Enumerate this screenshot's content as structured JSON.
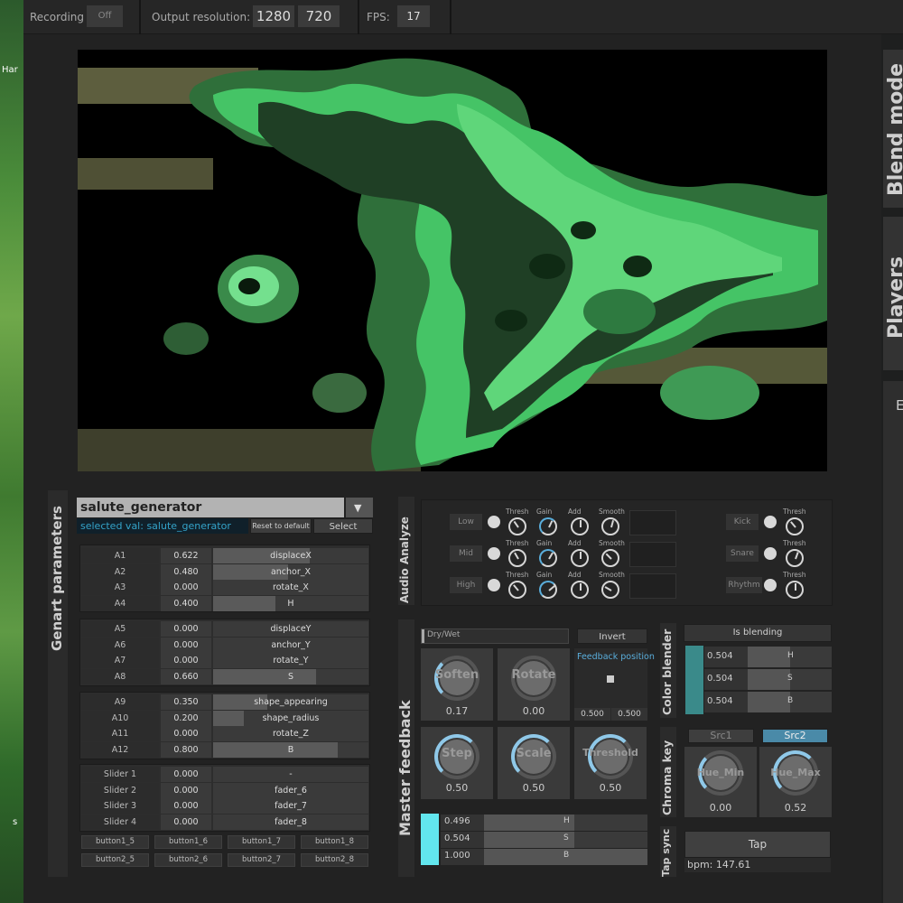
{
  "desktop": {
    "icon_label": "Har",
    "bottom_label": "s"
  },
  "topbar": {
    "recording_label": "Recording",
    "recording_value": "Off",
    "resolution_label": "Output resolution:",
    "res_w": "1280",
    "res_h": "720",
    "fps_label": "FPS:",
    "fps_value": "17"
  },
  "side_tabs": {
    "blend": "Blend mode",
    "players": "Players",
    "third": "E"
  },
  "genart": {
    "section_title": "Genart parameters",
    "selected_generator": "salute_generator",
    "selected_val_text": "selected val: salute_generator",
    "reset_label": "Reset to default",
    "select_label": "Select",
    "groups": [
      [
        {
          "name": "A1",
          "value": "0.622",
          "target": "displaceX",
          "level": 0.622
        },
        {
          "name": "A2",
          "value": "0.480",
          "target": "anchor_X",
          "level": 0.48
        },
        {
          "name": "A3",
          "value": "0.000",
          "target": "rotate_X",
          "level": 0
        },
        {
          "name": "A4",
          "value": "0.400",
          "target": "H",
          "level": 0.4
        }
      ],
      [
        {
          "name": "A5",
          "value": "0.000",
          "target": "displaceY",
          "level": 0
        },
        {
          "name": "A6",
          "value": "0.000",
          "target": "anchor_Y",
          "level": 0
        },
        {
          "name": "A7",
          "value": "0.000",
          "target": "rotate_Y",
          "level": 0
        },
        {
          "name": "A8",
          "value": "0.660",
          "target": "S",
          "level": 0.66
        }
      ],
      [
        {
          "name": "A9",
          "value": "0.350",
          "target": "shape_appearing",
          "level": 0.35
        },
        {
          "name": "A10",
          "value": "0.200",
          "target": "shape_radius",
          "level": 0.2
        },
        {
          "name": "A11",
          "value": "0.000",
          "target": "rotate_Z",
          "level": 0
        },
        {
          "name": "A12",
          "value": "0.800",
          "target": "B",
          "level": 0.8
        }
      ],
      [
        {
          "name": "Slider 1",
          "value": "0.000",
          "target": "-",
          "level": 0
        },
        {
          "name": "Slider 2",
          "value": "0.000",
          "target": "fader_6",
          "level": 0
        },
        {
          "name": "Slider 3",
          "value": "0.000",
          "target": "fader_7",
          "level": 0
        },
        {
          "name": "Slider 4",
          "value": "0.000",
          "target": "fader_8",
          "level": 0
        }
      ]
    ],
    "buttons_row1": [
      "button1_5",
      "button1_6",
      "button1_7",
      "button1_8"
    ],
    "buttons_row2": [
      "button2_5",
      "button2_6",
      "button2_7",
      "button2_8"
    ]
  },
  "audio": {
    "section_title": "Audio Analyze",
    "bands": [
      "Low",
      "Mid",
      "High"
    ],
    "knob_labels": [
      "Thresh",
      "Gain",
      "Add",
      "Smooth"
    ],
    "beats": [
      "Kick",
      "Snare",
      "Rhythm"
    ],
    "beat_knob_label": "Thresh"
  },
  "feedback": {
    "section_title": "Master feedback",
    "drywet_label": "Dry/Wet",
    "invert_label": "Invert",
    "position_label": "Feedback position",
    "pos_x": "0.500",
    "pos_y": "0.500",
    "knobs": [
      {
        "label": "Soften",
        "value": "0.17"
      },
      {
        "label": "Rotate",
        "value": "0.00"
      },
      {
        "label": "Step",
        "value": "0.50"
      },
      {
        "label": "Scale",
        "value": "0.50"
      },
      {
        "label": "Threshold",
        "value": "0.50"
      }
    ],
    "rgb_rows": [
      {
        "value": "0.496",
        "channel": "H",
        "level": 0.55
      },
      {
        "value": "0.504",
        "channel": "S",
        "level": 0.55
      },
      {
        "value": "1.000",
        "channel": "B",
        "level": 1.0
      }
    ]
  },
  "color_blender": {
    "section_title": "Color blender",
    "is_blending_label": "Is blending",
    "rows": [
      {
        "value": "0.504",
        "channel": "H"
      },
      {
        "value": "0.504",
        "channel": "S"
      },
      {
        "value": "0.504",
        "channel": "B"
      }
    ]
  },
  "chroma": {
    "section_title": "Chroma key",
    "src1": "Src1",
    "src2": "Src2",
    "knobs": [
      {
        "label": "Hue_Min",
        "value": "0.00"
      },
      {
        "label": "Hue_Max",
        "value": "0.52"
      }
    ]
  },
  "tapsync": {
    "section_title": "Tap sync",
    "tap_label": "Tap",
    "bpm_text": "bpm: 147.61"
  },
  "colors": {
    "accent_teal": "#3a8a8a",
    "accent_cyan": "#62e6ee",
    "accent_blue": "#8fc8e8",
    "src2_active": "#4a8aa8",
    "art_green": "#45c466",
    "art_olive": "#6a6a45"
  }
}
